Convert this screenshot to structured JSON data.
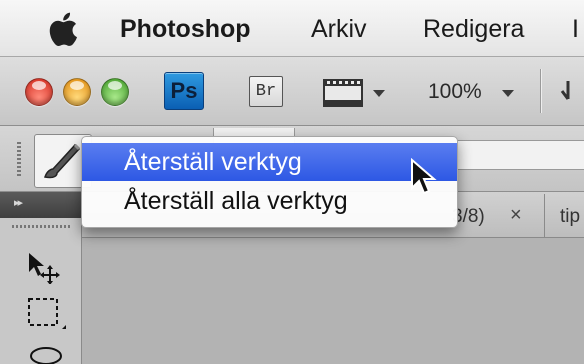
{
  "menubar": {
    "apple_icon": "apple-icon",
    "app_name": "Photoshop",
    "items": [
      "Arkiv",
      "Redigera",
      "I"
    ]
  },
  "appbar": {
    "ps_label": "Ps",
    "br_label": "Br",
    "zoom": "100%"
  },
  "tabs": {
    "active_suffix": "3/8)",
    "close": "×",
    "next_tab": "tip"
  },
  "panel": {
    "header": "▸▸"
  },
  "context_menu": {
    "items": [
      "Återställ verktyg",
      "Återställ alla verktyg"
    ],
    "selected_index": 0
  },
  "colors": {
    "selection": "#2d58e4",
    "ps_blue": "#0b5fb3"
  }
}
